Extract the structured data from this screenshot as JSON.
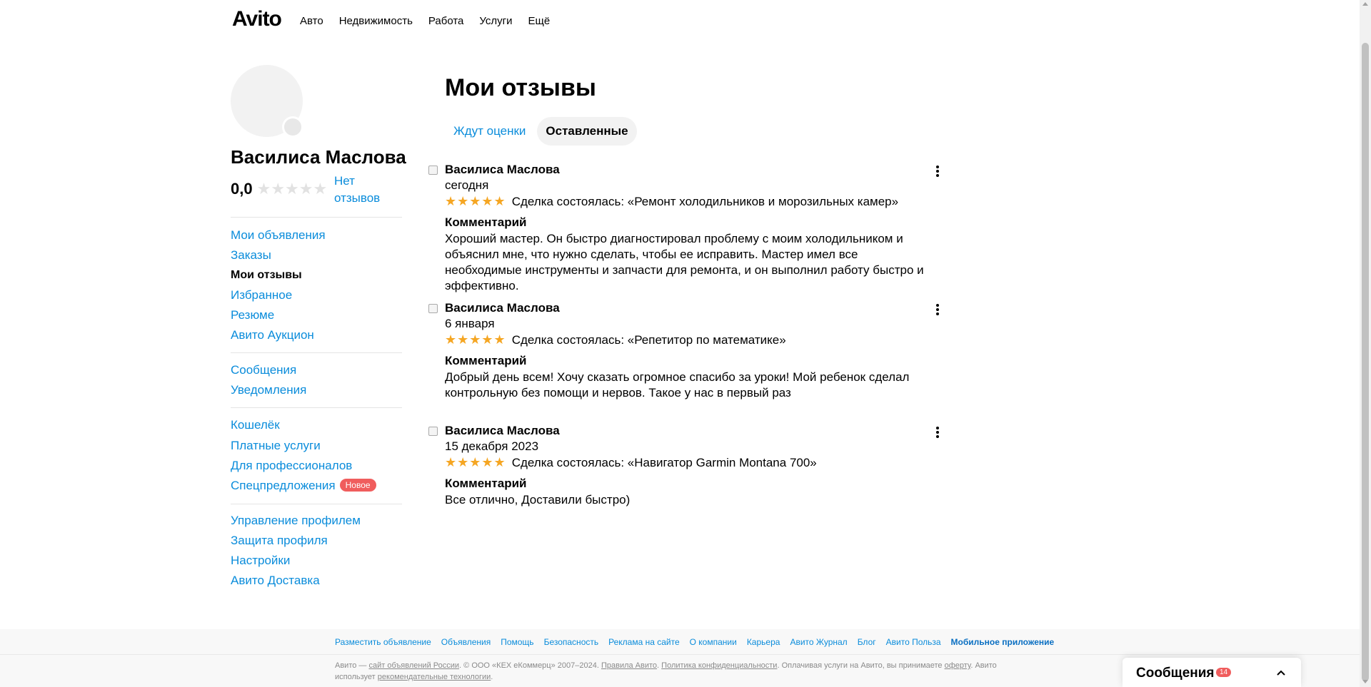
{
  "header": {
    "logo": "Avito",
    "nav": [
      "Авто",
      "Недвижимость",
      "Работа",
      "Услуги",
      "Ещё"
    ]
  },
  "profile": {
    "name": "Василиса Маслова",
    "rating": "0,0",
    "stars_filled": 0,
    "stars_total": 5,
    "no_reviews_label": "Нет отзывов"
  },
  "sidebar": {
    "group1": [
      "Мои объявления",
      "Заказы",
      "Мои отзывы",
      "Избранное",
      "Резюме",
      "Авито Аукцион"
    ],
    "group2": [
      "Сообщения",
      "Уведомления"
    ],
    "group3": [
      "Кошелёк",
      "Платные услуги",
      "Для профессионалов",
      "Спецпредложения"
    ],
    "new_badge": "Новое",
    "group4": [
      "Управление профилем",
      "Защита профиля",
      "Настройки",
      "Авито Доставка"
    ],
    "active": "Мои отзывы"
  },
  "main": {
    "title": "Мои отзывы",
    "tabs": [
      "Ждут оценки",
      "Оставленные"
    ],
    "selected_tab": "Оставленные",
    "comment_label": "Комментарий",
    "reviews": [
      {
        "author": "Василиса Маслова",
        "date": "сегодня",
        "rating": 5,
        "deal": "Сделка состоялась: «Ремонт холодильников и морозильных камер»",
        "comment": "Хороший мастер. Он быстро диагностировал проблему с моим холодильником и объяснил мне, что нужно сделать, чтобы ее исправить. Мастер имел все необходимые инструменты и запчасти для ремонта, и он выполнил работу быстро и эффективно."
      },
      {
        "author": "Василиса Маслова",
        "date": "6 января",
        "rating": 5,
        "deal": "Сделка состоялась: «Репетитор по математике»",
        "comment": "Добрый день всем! Хочу сказать огромное спасибо за уроки! Мой ребенок сделал контрольную без помощи и нервов. Такое у нас в первый раз"
      },
      {
        "author": "Василиса Маслова",
        "date": "15 декабря 2023",
        "rating": 5,
        "deal": "Сделка состоялась: «Навигатор Garmin Montana 700»",
        "comment": "Все отлично, Доставили быстро)"
      }
    ]
  },
  "footer": {
    "links": [
      "Разместить объявление",
      "Объявления",
      "Помощь",
      "Безопасность",
      "Реклама на сайте",
      "О компании",
      "Карьера",
      "Авито Журнал",
      "Блог",
      "Авито Польза",
      "Мобильное приложение"
    ],
    "legal": {
      "p1": "Авито — ",
      "link1": "сайт объявлений России",
      "p2": ". © ООО «КЕХ еКоммерц» 2007–2024. ",
      "link2": "Правила Авито",
      "p3": ". ",
      "link3": "Политика конфиденциальности",
      "p4": ". Оплачивая услуги на Авито, вы принимаете ",
      "link4": "оферту",
      "p5": ". Авито использует ",
      "link5": "рекомендательные технологии",
      "p6": "."
    }
  },
  "messenger": {
    "title": "Сообщения",
    "count": "14"
  },
  "colors": {
    "link": "#0a8cdb",
    "star_filled": "#f5a623",
    "star_empty": "#e2e2e2",
    "badge": "#f05d5d"
  }
}
